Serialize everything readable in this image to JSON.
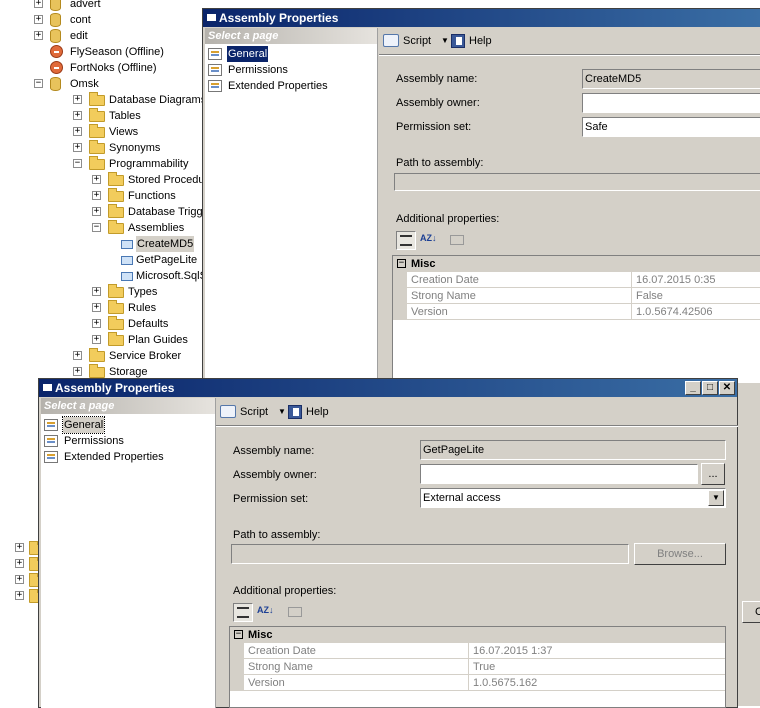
{
  "tree": {
    "nodes": [
      {
        "label": "advert",
        "kind": "db",
        "expander": "+"
      },
      {
        "label": "cont",
        "kind": "db",
        "expander": "+"
      },
      {
        "label": "edit",
        "kind": "db",
        "expander": "+"
      },
      {
        "label": "FlySeason (Offline)",
        "kind": "db-offline",
        "expander": ""
      },
      {
        "label": "FortNoks (Offline)",
        "kind": "db-offline",
        "expander": ""
      },
      {
        "label": "Omsk",
        "kind": "db",
        "expander": "−"
      },
      {
        "label": "Database Diagrams",
        "kind": "folder",
        "expander": "+"
      },
      {
        "label": "Tables",
        "kind": "folder",
        "expander": "+"
      },
      {
        "label": "Views",
        "kind": "folder",
        "expander": "+"
      },
      {
        "label": "Synonyms",
        "kind": "folder",
        "expander": "+"
      },
      {
        "label": "Programmability",
        "kind": "folder",
        "expander": "−"
      },
      {
        "label": "Stored Procedures",
        "kind": "folder",
        "expander": "+"
      },
      {
        "label": "Functions",
        "kind": "folder",
        "expander": "+"
      },
      {
        "label": "Database Triggers",
        "kind": "folder",
        "expander": "+"
      },
      {
        "label": "Assemblies",
        "kind": "folder",
        "expander": "−"
      },
      {
        "label": "CreateMD5",
        "kind": "assembly",
        "expander": ""
      },
      {
        "label": "GetPageLite",
        "kind": "assembly",
        "expander": ""
      },
      {
        "label": "Microsoft.SqlSe",
        "kind": "assembly",
        "expander": ""
      },
      {
        "label": "Types",
        "kind": "folder",
        "expander": "+"
      },
      {
        "label": "Rules",
        "kind": "folder",
        "expander": "+"
      },
      {
        "label": "Defaults",
        "kind": "folder",
        "expander": "+"
      },
      {
        "label": "Plan Guides",
        "kind": "folder",
        "expander": "+"
      },
      {
        "label": "Service Broker",
        "kind": "folder",
        "expander": "+"
      },
      {
        "label": "Storage",
        "kind": "folder",
        "expander": "+"
      }
    ],
    "lower_expanders": [
      "+",
      "+",
      "+",
      "+"
    ]
  },
  "dialog_back": {
    "title": "Assembly Properties",
    "select_page": "Select a page",
    "pages": [
      "General",
      "Permissions",
      "Extended Properties"
    ],
    "toolbar": {
      "script": "Script",
      "help": "Help"
    },
    "labels": {
      "assembly_name": "Assembly name:",
      "assembly_owner": "Assembly owner:",
      "permission_set": "Permission set:",
      "path": "Path to assembly:",
      "additional": "Additional properties:"
    },
    "values": {
      "assembly_name": "CreateMD5",
      "assembly_owner": "",
      "permission_set": "Safe",
      "path": ""
    },
    "grid": {
      "category": "Misc",
      "toggle": "⊟",
      "rows": [
        {
          "name": "Creation Date",
          "value": "16.07.2015 0:35"
        },
        {
          "name": "Strong Name",
          "value": "False"
        },
        {
          "name": "Version",
          "value": "1.0.5674.42506"
        }
      ]
    }
  },
  "dialog_front": {
    "title": "Assembly Properties",
    "window_buttons": {
      "minimize": "_",
      "maximize": "□",
      "close": "✕"
    },
    "select_page": "Select a page",
    "pages": [
      "General",
      "Permissions",
      "Extended Properties"
    ],
    "toolbar": {
      "script": "Script",
      "help": "Help"
    },
    "labels": {
      "assembly_name": "Assembly name:",
      "assembly_owner": "Assembly owner:",
      "permission_set": "Permission set:",
      "path": "Path to assembly:",
      "additional": "Additional properties:"
    },
    "values": {
      "assembly_name": "GetPageLite",
      "assembly_owner": "",
      "permission_set": "External access",
      "path": ""
    },
    "owner_browse": "...",
    "browse_button": "Browse...",
    "grid": {
      "category": "Misc",
      "toggle": "⊟",
      "rows": [
        {
          "name": "Creation Date",
          "value": "16.07.2015 1:37"
        },
        {
          "name": "Strong Name",
          "value": "True"
        },
        {
          "name": "Version",
          "value": "1.0.5675.162"
        }
      ]
    }
  },
  "edge_button": "C"
}
